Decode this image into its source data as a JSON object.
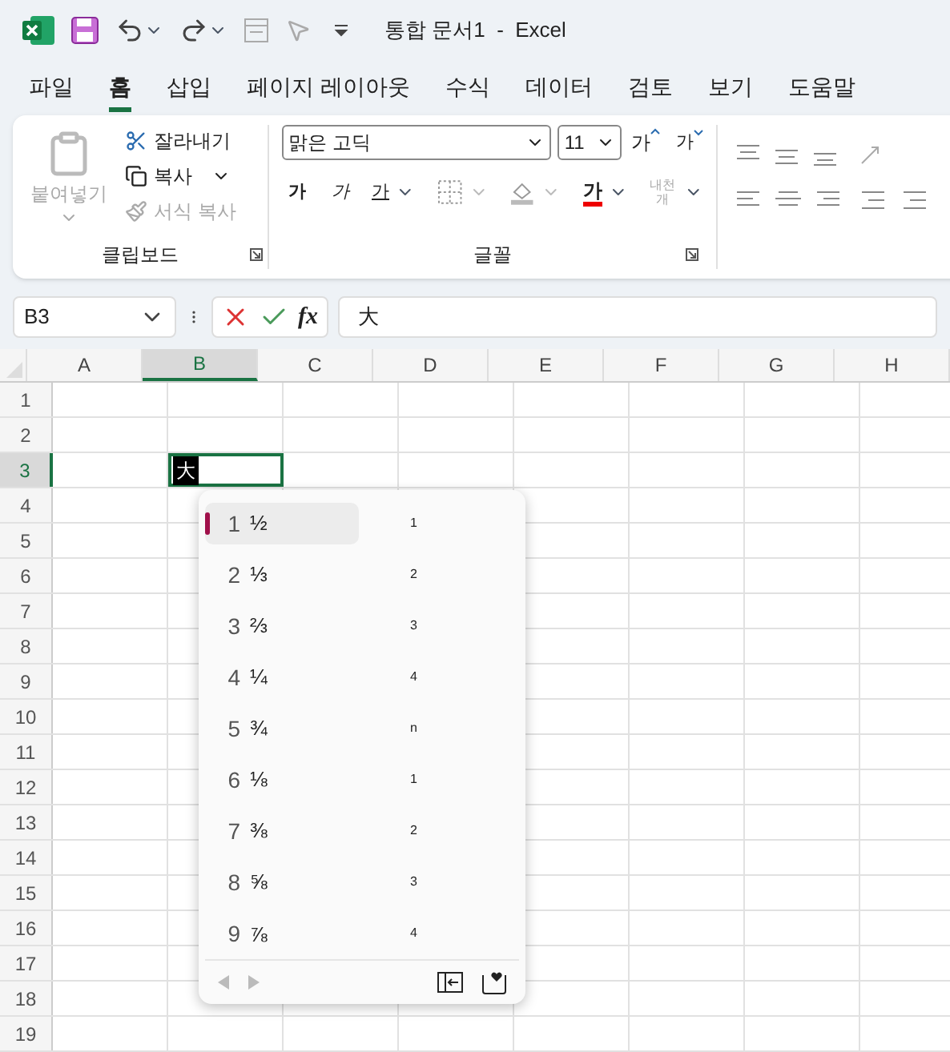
{
  "title_bar": {
    "title": "통합 문서1  -  Excel"
  },
  "ribbon_tabs": [
    {
      "label": "파일",
      "selected": false
    },
    {
      "label": "홈",
      "selected": true
    },
    {
      "label": "삽입",
      "selected": false
    },
    {
      "label": "페이지 레이아웃",
      "selected": false
    },
    {
      "label": "수식",
      "selected": false
    },
    {
      "label": "데이터",
      "selected": false
    },
    {
      "label": "검토",
      "selected": false
    },
    {
      "label": "보기",
      "selected": false
    },
    {
      "label": "도움말",
      "selected": false
    }
  ],
  "clipboard": {
    "paste": "붙여넣기",
    "cut": "잘라내기",
    "copy": "복사",
    "format_painter": "서식 복사",
    "label": "클립보드"
  },
  "font": {
    "font_name": "맑은 고딕",
    "font_size": "11",
    "grow": "가",
    "shrink": "가",
    "bold": "가",
    "italic": "가",
    "underline": "가",
    "font_color": "가",
    "phonetic": "내천 개",
    "label": "글꼴"
  },
  "formula_bar": {
    "name_box": "B3",
    "fx": "fx",
    "value": "大"
  },
  "columns": [
    {
      "label": "A",
      "selected": false
    },
    {
      "label": "B",
      "selected": true
    },
    {
      "label": "C",
      "selected": false
    },
    {
      "label": "D",
      "selected": false
    },
    {
      "label": "E",
      "selected": false
    },
    {
      "label": "F",
      "selected": false
    },
    {
      "label": "G",
      "selected": false
    },
    {
      "label": "H",
      "selected": false
    }
  ],
  "rows": [
    {
      "label": "1",
      "selected": false
    },
    {
      "label": "2",
      "selected": false
    },
    {
      "label": "3",
      "selected": true
    },
    {
      "label": "4",
      "selected": false
    },
    {
      "label": "5",
      "selected": false
    },
    {
      "label": "6",
      "selected": false
    },
    {
      "label": "7",
      "selected": false
    },
    {
      "label": "8",
      "selected": false
    },
    {
      "label": "9",
      "selected": false
    },
    {
      "label": "10",
      "selected": false
    },
    {
      "label": "11",
      "selected": false
    },
    {
      "label": "12",
      "selected": false
    },
    {
      "label": "13",
      "selected": false
    },
    {
      "label": "14",
      "selected": false
    },
    {
      "label": "15",
      "selected": false
    },
    {
      "label": "16",
      "selected": false
    },
    {
      "label": "17",
      "selected": false
    },
    {
      "label": "18",
      "selected": false
    },
    {
      "label": "19",
      "selected": false
    }
  ],
  "active_cell": {
    "value": "大"
  },
  "candidates": [
    {
      "number": "1",
      "text": "½",
      "hint": "1",
      "selected": true
    },
    {
      "number": "2",
      "text": "⅓",
      "hint": "2",
      "selected": false
    },
    {
      "number": "3",
      "text": "⅔",
      "hint": "3",
      "selected": false
    },
    {
      "number": "4",
      "text": "¼",
      "hint": "4",
      "selected": false
    },
    {
      "number": "5",
      "text": "¾",
      "hint": "n",
      "selected": false
    },
    {
      "number": "6",
      "text": "⅛",
      "hint": "1",
      "selected": false
    },
    {
      "number": "7",
      "text": "⅜",
      "hint": "2",
      "selected": false
    },
    {
      "number": "8",
      "text": "⅝",
      "hint": "3",
      "selected": false
    },
    {
      "number": "9",
      "text": "⅞",
      "hint": "4",
      "selected": false
    }
  ]
}
